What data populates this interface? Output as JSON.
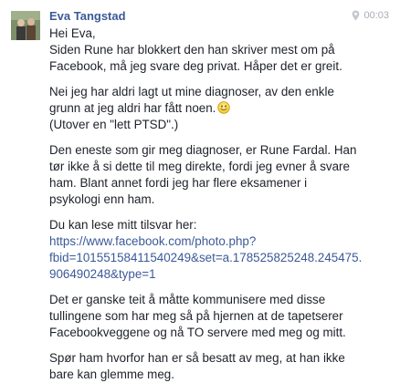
{
  "message": {
    "sender_name": "Eva Tangstad",
    "timestamp": "00:03",
    "location_icon": "map-pin-icon",
    "emoji_icon": "smiley-icon",
    "paragraphs": [
      {
        "lines": [
          "Hei Eva,",
          "Siden Rune har blokkert den han skriver mest om på",
          "Facebook, må jeg svare deg privat. Håper det er greit."
        ]
      },
      {
        "lines": [
          "Nei jeg har aldri lagt ut mine diagnoser, av den enkle",
          "grunn at jeg aldri har fått noen.",
          "(Utover en \"lett PTSD\".)"
        ]
      },
      {
        "lines": [
          "Den eneste som gir meg diagnoser, er Rune Fardal. Han",
          "tør ikke å si dette til meg direkte, fordi jeg  evner å svare",
          "ham. Blant annet fordi jeg har flere eksamener i",
          "psykologi enn ham."
        ]
      },
      {
        "lines": [
          "Du kan lese mitt tilsvar her:"
        ],
        "link_lines": [
          "https://www.facebook.com/photo.php?",
          "fbid=10155158411540249&set=a.178525825248.245475.",
          "906490248&type=1"
        ]
      },
      {
        "lines": [
          "Det er ganske teit å måtte kommunisere med disse",
          "tullingene som har meg så på hjernen at de tapetserer",
          "Facebookveggene og nå TO servere med meg og mitt."
        ]
      },
      {
        "lines": [
          "Spør ham hvorfor han er så besatt av meg, at han ikke",
          "bare kan glemme meg."
        ]
      }
    ]
  }
}
